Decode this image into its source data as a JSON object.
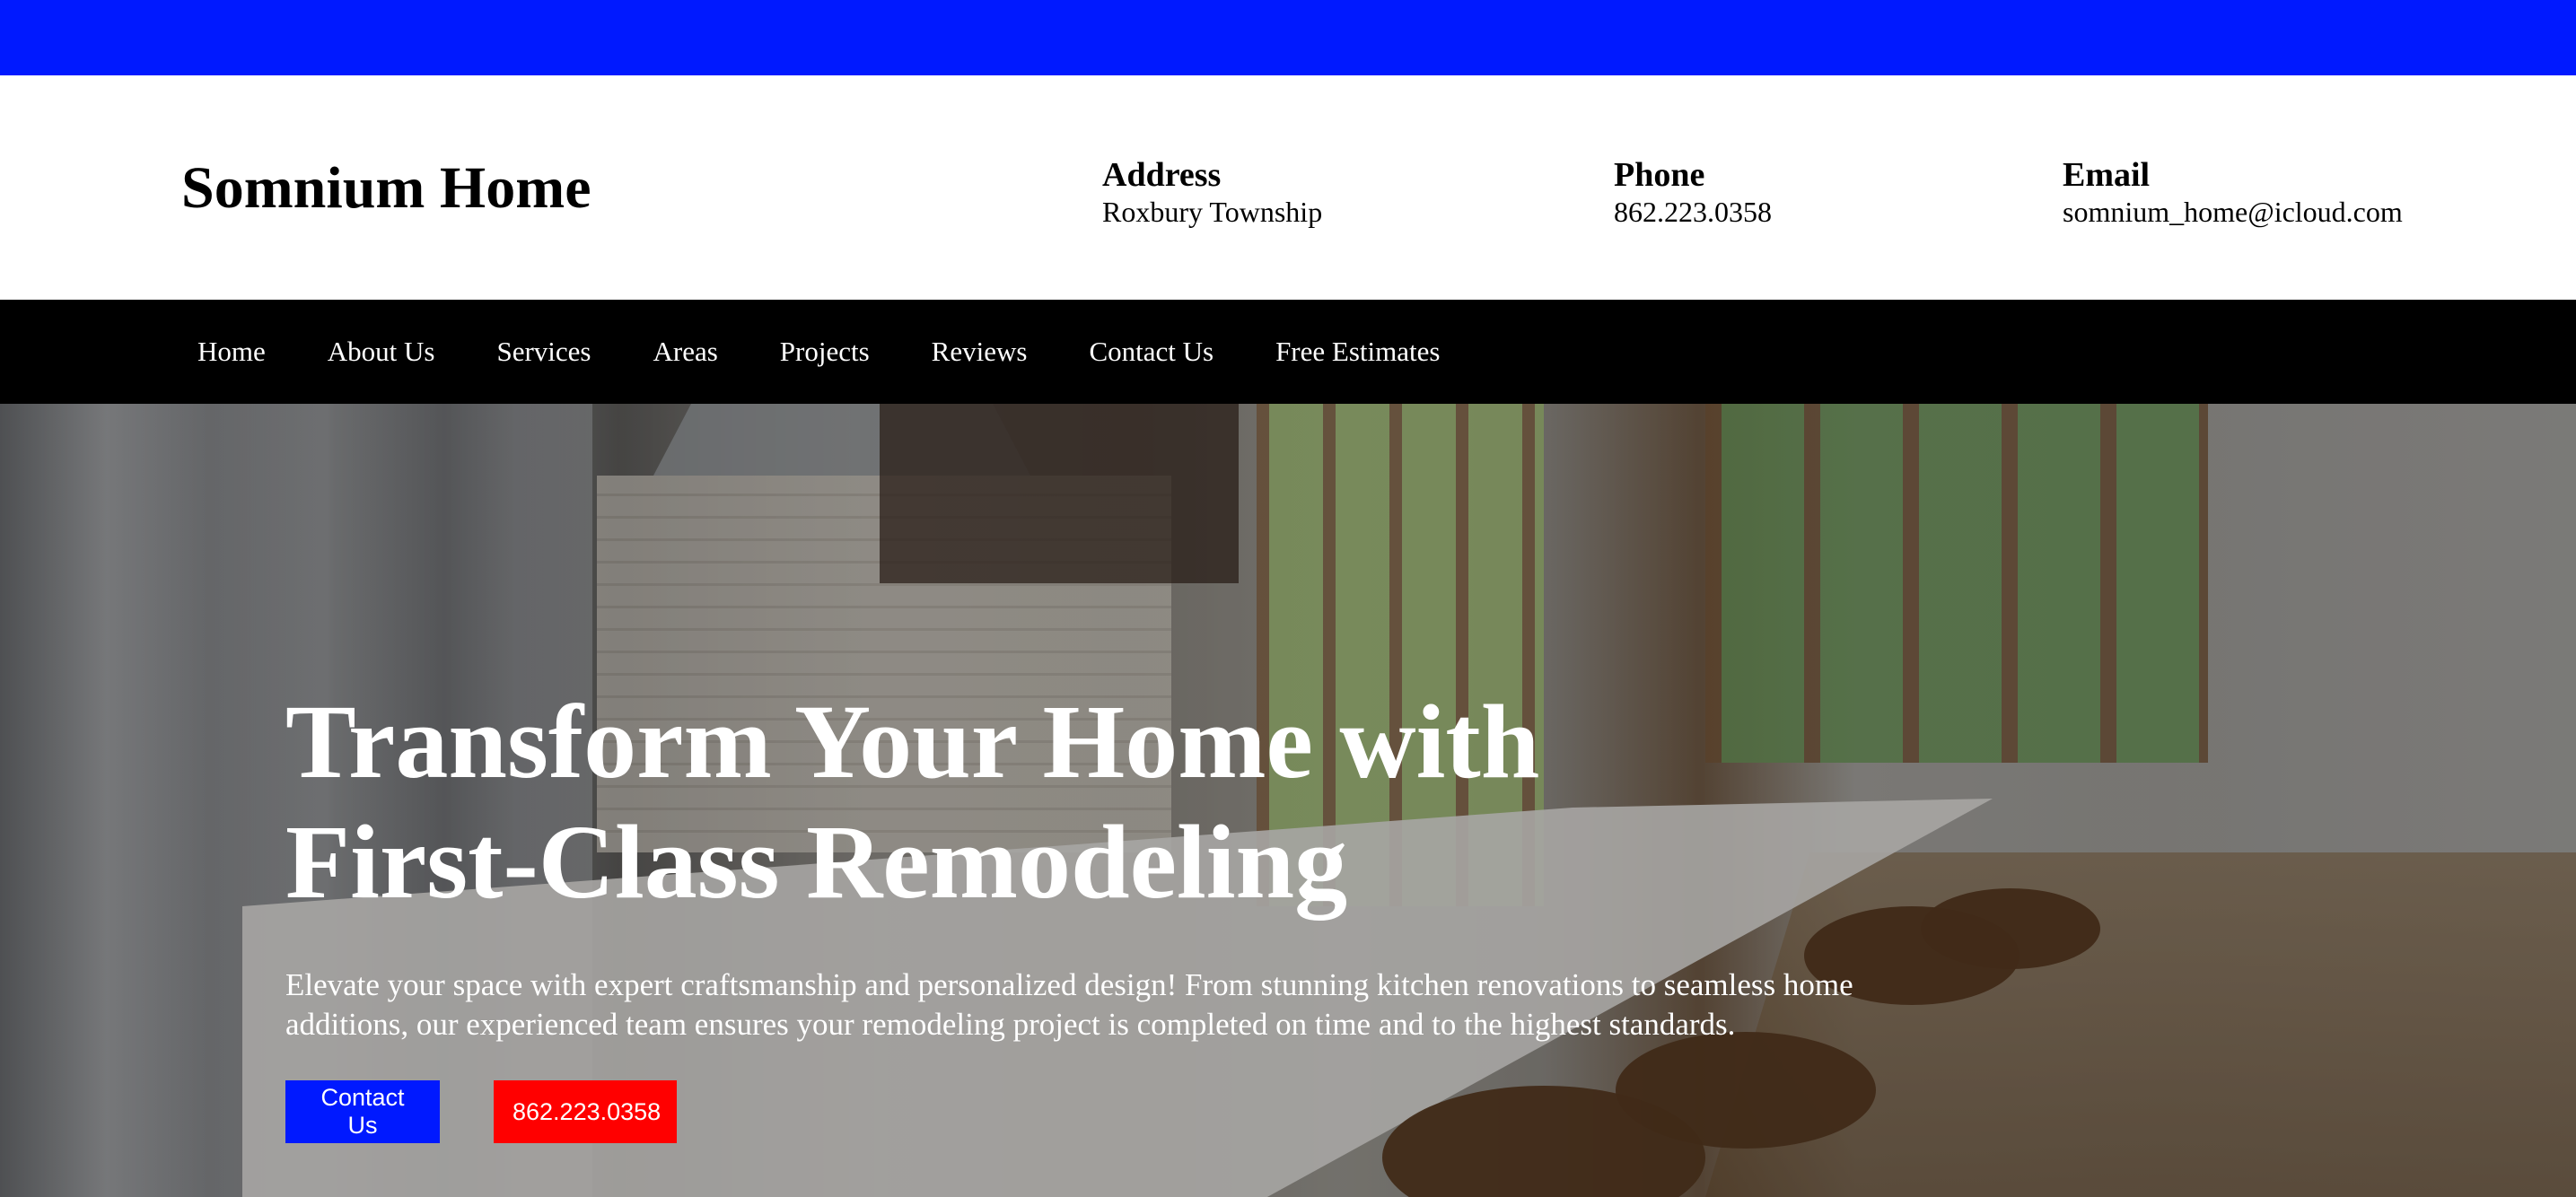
{
  "brand": "Somnium Home",
  "contact": {
    "address_label": "Address",
    "address_value": "Roxbury Township",
    "phone_label": "Phone",
    "phone_value": "862.223.0358",
    "email_label": "Email",
    "email_value": "somnium_home@icloud.com"
  },
  "nav": {
    "items": [
      {
        "label": "Home"
      },
      {
        "label": "About Us"
      },
      {
        "label": "Services"
      },
      {
        "label": "Areas"
      },
      {
        "label": "Projects"
      },
      {
        "label": "Reviews"
      },
      {
        "label": "Contact Us"
      },
      {
        "label": "Free Estimates"
      }
    ]
  },
  "hero": {
    "title": "Transform Your Home with First-Class Remodeling",
    "description": "Elevate your space with expert craftsmanship and personalized design! From stunning kitchen renovations to seamless home additions, our experienced team ensures your remodeling project is completed on time and to the highest standards.",
    "primary_button": "Contact Us",
    "secondary_button": "862.223.0358"
  },
  "colors": {
    "topbar": "#0019ff",
    "nav_background": "#000000",
    "primary_button": "#0019ff",
    "secondary_button": "#ff0000"
  }
}
